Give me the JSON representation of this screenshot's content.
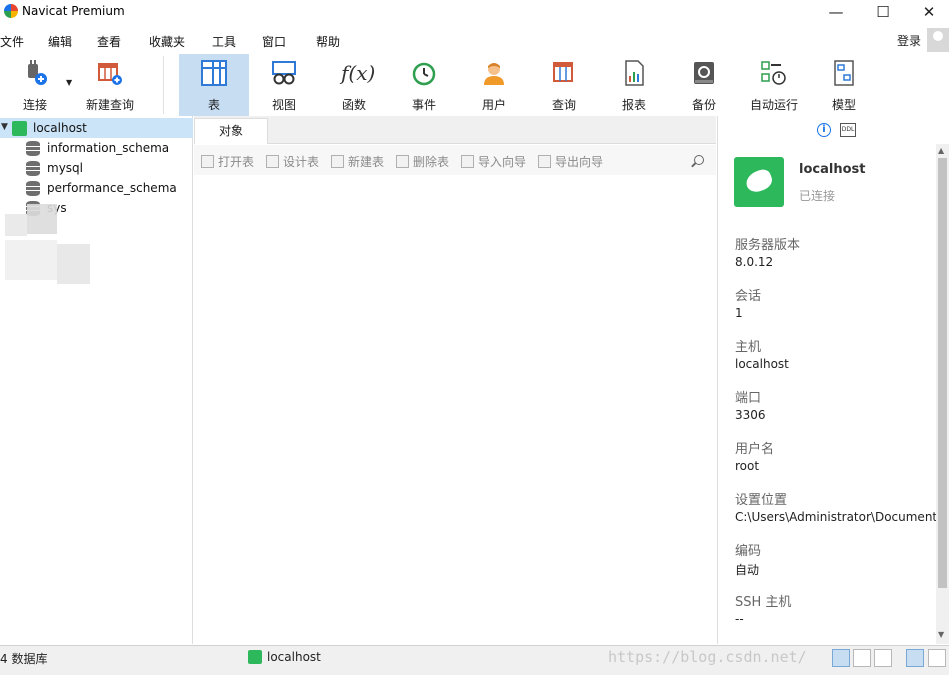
{
  "window": {
    "title": "Navicat Premium",
    "minimize": "—",
    "maximize": "☐",
    "close": "✕"
  },
  "menu": [
    "文件",
    "编辑",
    "查看",
    "收藏夹",
    "工具",
    "窗口",
    "帮助"
  ],
  "login": "登录",
  "toolbar": {
    "connect": "连接",
    "new_query": "新建查询",
    "buttons": [
      "表",
      "视图",
      "函数",
      "事件",
      "用户",
      "查询",
      "报表",
      "备份",
      "自动运行",
      "模型"
    ],
    "active": "表"
  },
  "tree": {
    "connection": "localhost",
    "databases": [
      "information_schema",
      "mysql",
      "performance_schema",
      "sys"
    ]
  },
  "objects": {
    "tab": "对象",
    "actions": [
      "打开表",
      "设计表",
      "新建表",
      "删除表",
      "导入向导",
      "导出向导"
    ]
  },
  "info_panel": {
    "info_icon": "i",
    "ddl_icon": "DDL",
    "name": "localhost",
    "state": "已连接",
    "fields": [
      {
        "label": "服务器版本",
        "value": "8.0.12"
      },
      {
        "label": "会话",
        "value": "1"
      },
      {
        "label": "主机",
        "value": "localhost"
      },
      {
        "label": "端口",
        "value": "3306"
      },
      {
        "label": "用户名",
        "value": "root"
      },
      {
        "label": "设置位置",
        "value": "C:\\Users\\Administrator\\Documents"
      },
      {
        "label": "编码",
        "value": "自动"
      },
      {
        "label": "SSH 主机",
        "value": "--"
      }
    ]
  },
  "status": {
    "databases": "4 数据库",
    "connection": "localhost",
    "watermark": "https://blog.csdn.net/"
  }
}
